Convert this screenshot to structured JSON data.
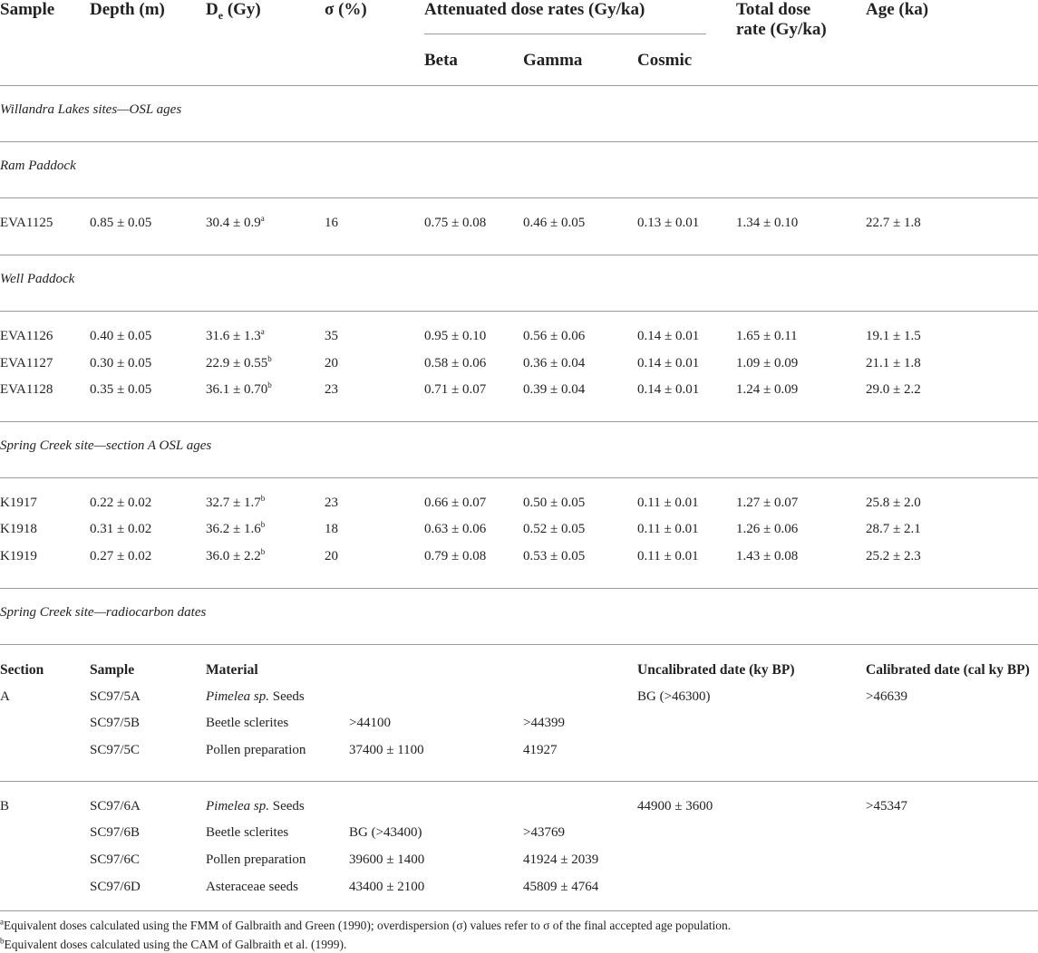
{
  "header": {
    "sample": "Sample",
    "depth": "Depth (m)",
    "de_main": "D",
    "de_sub": "e",
    "de_unit": " (Gy)",
    "sigma": "σ (%)",
    "attenuated": "Attenuated dose rates (Gy/ka)",
    "beta": "Beta",
    "gamma": "Gamma",
    "cosmic": "Cosmic",
    "total_line1": "Total dose",
    "total_line2": "rate (Gy/ka)",
    "age": "Age (ka)"
  },
  "sections": {
    "willandra": "Willandra Lakes sites—OSL ages",
    "ram": "Ram Paddock",
    "well": "Well Paddock",
    "spring_a": "Spring Creek site—section A OSL ages",
    "spring_rc": "Spring Creek site—radiocarbon dates"
  },
  "ram_rows": [
    {
      "sample": "EVA1125",
      "depth": "0.85 ± 0.05",
      "de": "30.4 ± 0.9",
      "de_note": "a",
      "sigma": "16",
      "beta": "0.75 ± 0.08",
      "gamma": "0.46 ± 0.05",
      "cosmic": "0.13 ± 0.01",
      "total": "1.34 ± 0.10",
      "age": "22.7 ± 1.8"
    }
  ],
  "well_rows": [
    {
      "sample": "EVA1126",
      "depth": "0.40 ± 0.05",
      "de": "31.6 ± 1.3",
      "de_note": "a",
      "sigma": "35",
      "beta": "0.95 ± 0.10",
      "gamma": "0.56 ± 0.06",
      "cosmic": "0.14 ± 0.01",
      "total": "1.65 ± 0.11",
      "age": "19.1 ± 1.5"
    },
    {
      "sample": "EVA1127",
      "depth": "0.30 ± 0.05",
      "de": "22.9 ± 0.55",
      "de_note": "b",
      "sigma": "20",
      "beta": "0.58 ± 0.06",
      "gamma": "0.36 ± 0.04",
      "cosmic": "0.14 ± 0.01",
      "total": "1.09 ± 0.09",
      "age": "21.1 ± 1.8"
    },
    {
      "sample": "EVA1128",
      "depth": "0.35 ± 0.05",
      "de": "36.1 ± 0.70",
      "de_note": "b",
      "sigma": "23",
      "beta": "0.71 ± 0.07",
      "gamma": "0.39 ± 0.04",
      "cosmic": "0.14 ± 0.01",
      "total": "1.24 ± 0.09",
      "age": "29.0 ± 2.2"
    }
  ],
  "spring_rows": [
    {
      "sample": "K1917",
      "depth": "0.22 ± 0.02",
      "de": "32.7 ± 1.7",
      "de_note": "b",
      "sigma": "23",
      "beta": "0.66 ± 0.07",
      "gamma": "0.50 ± 0.05",
      "cosmic": "0.11 ± 0.01",
      "total": "1.27 ± 0.07",
      "age": "25.8 ± 2.0"
    },
    {
      "sample": "K1918",
      "depth": "0.31 ± 0.02",
      "de": "36.2 ± 1.6",
      "de_note": "b",
      "sigma": "18",
      "beta": "0.63 ± 0.06",
      "gamma": "0.52 ± 0.05",
      "cosmic": "0.11 ± 0.01",
      "total": "1.26 ± 0.06",
      "age": "28.7 ± 2.1"
    },
    {
      "sample": "K1919",
      "depth": "0.27 ± 0.02",
      "de": "36.0 ± 2.2",
      "de_note": "b",
      "sigma": "20",
      "beta": "0.79 ± 0.08",
      "gamma": "0.53 ± 0.05",
      "cosmic": "0.11 ± 0.01",
      "total": "1.43 ± 0.08",
      "age": "25.2 ± 2.3"
    }
  ],
  "rc_header": {
    "section": "Section",
    "sample": "Sample",
    "material": "Material",
    "uncal": "Uncalibrated date (ky BP)",
    "cal": "Calibrated date (cal ky BP)"
  },
  "rc_group_a": {
    "section": "A",
    "rows": [
      {
        "sample": "SC97/5A",
        "material_it": "Pimelea sp.",
        "material": " Seeds",
        "c3": "",
        "c4": "",
        "uncal": "BG (>46300)",
        "cal": ">46639"
      },
      {
        "sample": "SC97/5B",
        "material_it": "",
        "material": "Beetle sclerites",
        "c3": ">44100",
        "c4": ">44399",
        "uncal": "",
        "cal": ""
      },
      {
        "sample": "SC97/5C",
        "material_it": "",
        "material": "Pollen preparation",
        "c3": "37400 ± 1100",
        "c4": "41927",
        "uncal": "",
        "cal": ""
      }
    ]
  },
  "rc_group_b": {
    "section": "B",
    "rows": [
      {
        "sample": "SC97/6A",
        "material_it": "Pimelea sp.",
        "material": " Seeds",
        "c3": "",
        "c4": "",
        "uncal": "44900 ± 3600",
        "cal": ">45347"
      },
      {
        "sample": "SC97/6B",
        "material_it": "",
        "material": "Beetle sclerites",
        "c3": "BG (>43400)",
        "c4": ">43769",
        "uncal": "",
        "cal": ""
      },
      {
        "sample": "SC97/6C",
        "material_it": "",
        "material": "Pollen preparation",
        "c3": "39600 ± 1400",
        "c4": "41924 ± 2039",
        "uncal": "",
        "cal": ""
      },
      {
        "sample": "SC97/6D",
        "material_it": "",
        "material": "Asteraceae seeds",
        "c3": "43400 ± 2100",
        "c4": "45809 ± 4764",
        "uncal": "",
        "cal": ""
      }
    ]
  },
  "footnotes": [
    {
      "mark": "a",
      "text": "Equivalent doses calculated using the FMM of Galbraith and Green (1990); overdispersion (σ) values refer to σ of the final accepted age population."
    },
    {
      "mark": "b",
      "text": "Equivalent doses calculated using the CAM of Galbraith et al. (1999)."
    }
  ]
}
